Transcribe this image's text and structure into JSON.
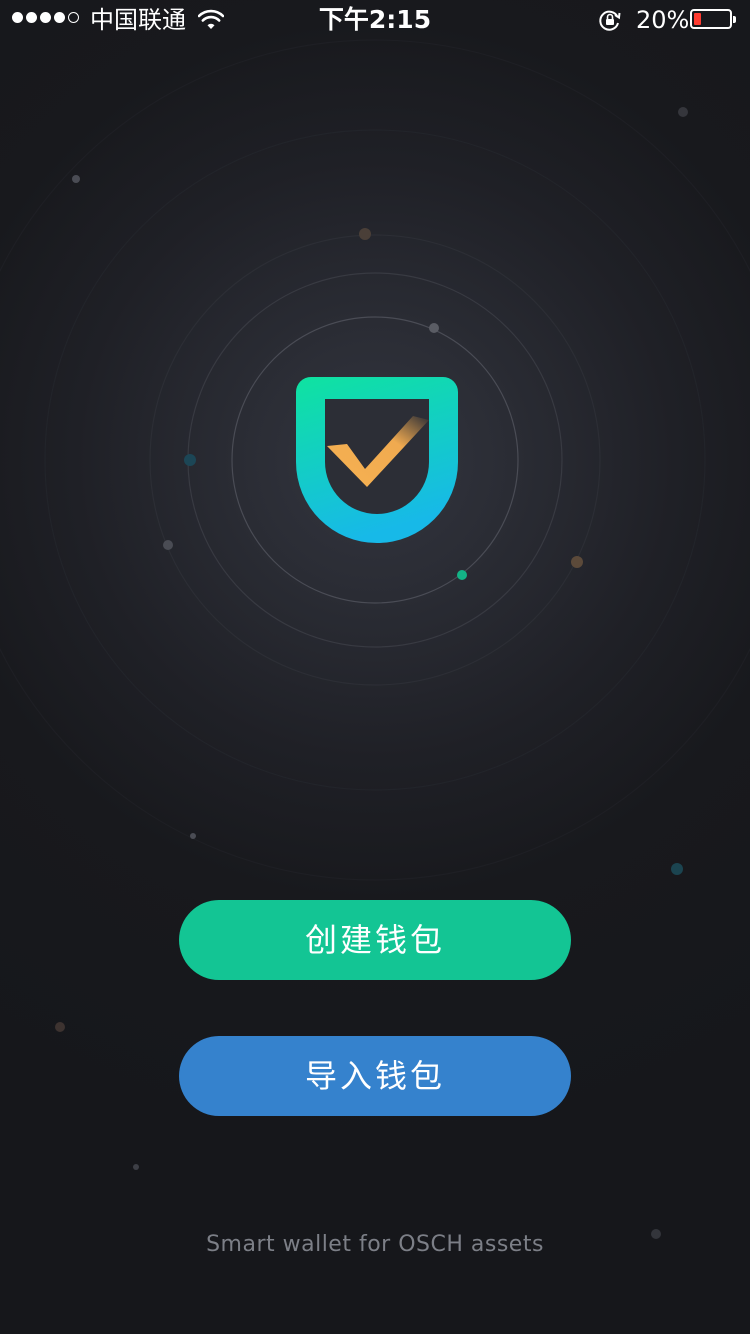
{
  "status_bar": {
    "carrier": "中国联通",
    "time": "下午2:15",
    "battery_percent": "20%",
    "battery_level": 0.2,
    "signal_bars_filled": 4,
    "signal_bars_total": 5,
    "icons": [
      "signal-dots-icon",
      "wifi-icon",
      "rotation-lock-icon",
      "battery-icon"
    ]
  },
  "logo": {
    "icon": "shield-check-icon",
    "colors": {
      "shield_gradient_start": "#0fe3a0",
      "shield_gradient_end": "#17b9e8",
      "check": "#f4b054"
    }
  },
  "actions": {
    "create_wallet_label": "创建钱包",
    "import_wallet_label": "导入钱包"
  },
  "footer": {
    "tagline": "Smart wallet for OSCH assets"
  },
  "colors": {
    "background": "#17181c",
    "create_button": "#13c594",
    "import_button": "#3582cd",
    "tagline": "#7c7f87"
  }
}
